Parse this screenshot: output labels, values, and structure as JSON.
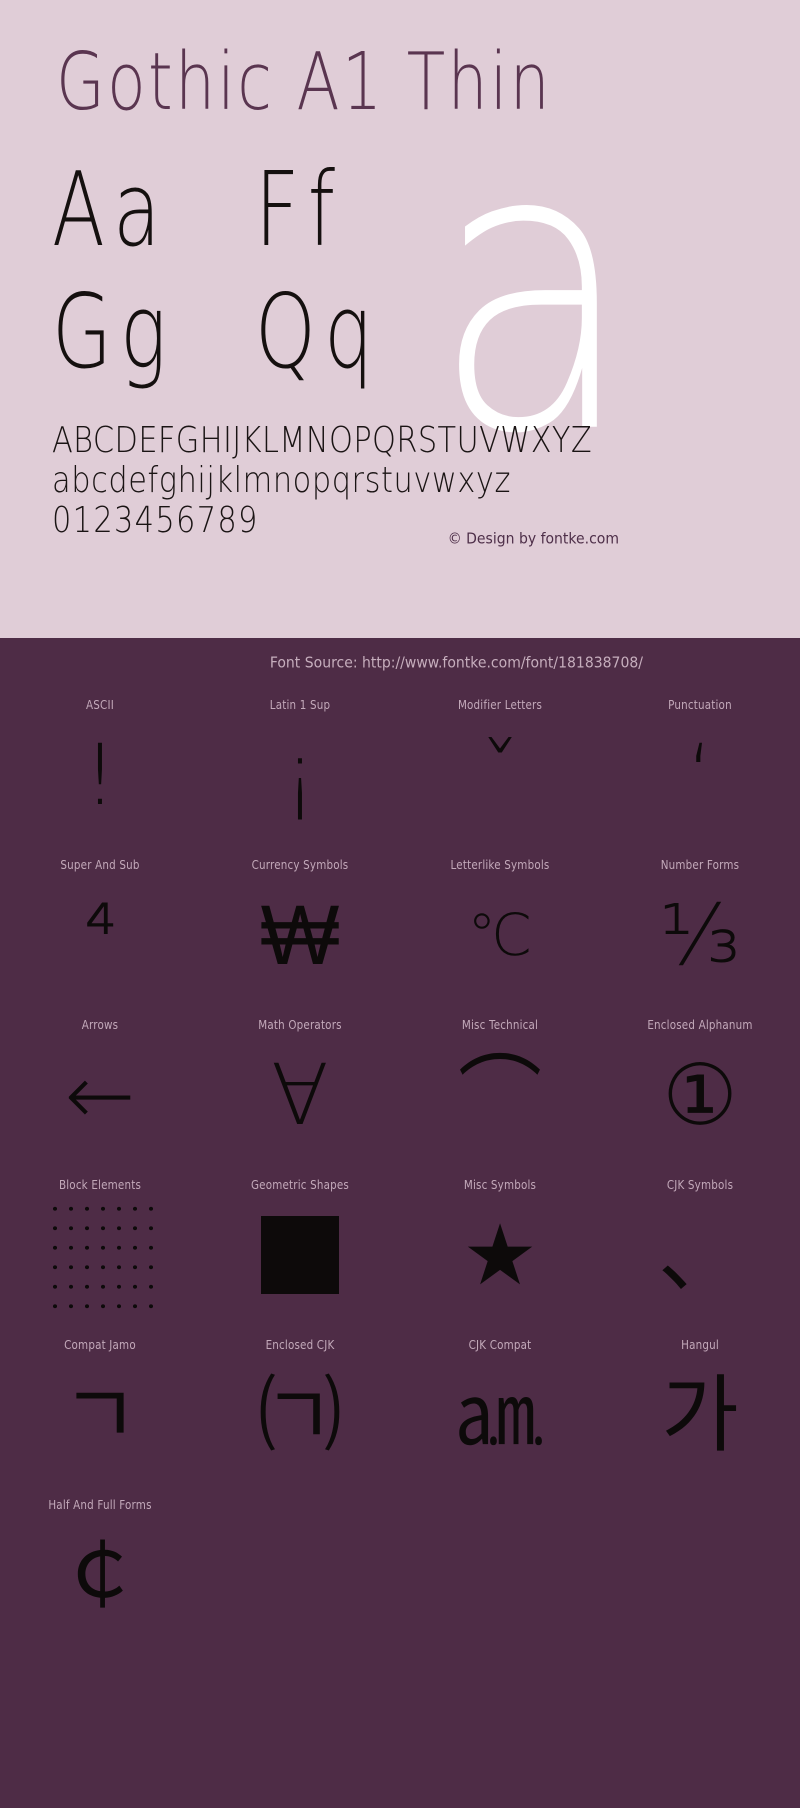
{
  "specimen": {
    "title": "Gothic A1 Thin",
    "sample_pairs": [
      "Aa",
      "Ff",
      "Gg",
      "Qq"
    ],
    "hero_glyph": "a",
    "charset": {
      "uppercase": "ABCDEFGHIJKLMNOPQRSTUVWXYZ",
      "lowercase": "abcdefghijklmnopqrstuvwxyz",
      "digits": "0123456789"
    },
    "copyright": "© Design by fontke.com",
    "font_source": "Font Source: http://www.fontke.com/font/181838708/",
    "colors": {
      "top_background": "#e0cdd7",
      "bottom_background": "#4e2c46",
      "title_color": "#5a3550",
      "glyph_color": "#0d0a0a",
      "hero_color": "#ffffff",
      "label_color": "#c3a9ba"
    }
  },
  "unicode_blocks": [
    {
      "label": "ASCII",
      "glyph": "!",
      "size": "normal"
    },
    {
      "label": "Latin 1 Sup",
      "glyph": "¡",
      "size": "normal"
    },
    {
      "label": "Modifier Letters",
      "glyph": "ˇ",
      "size": "normal"
    },
    {
      "label": "Punctuation",
      "glyph": "‘",
      "size": "normal"
    },
    {
      "label": "Super And Sub",
      "glyph": "⁴",
      "size": "normal"
    },
    {
      "label": "Currency Symbols",
      "glyph": "₩",
      "size": "normal"
    },
    {
      "label": "Letterlike Symbols",
      "glyph": "℃",
      "size": "small"
    },
    {
      "label": "Number Forms",
      "glyph": "⅓",
      "size": "normal"
    },
    {
      "label": "Arrows",
      "glyph": "←",
      "size": "normal"
    },
    {
      "label": "Math Operators",
      "glyph": "∀",
      "size": "normal"
    },
    {
      "label": "Misc Technical",
      "glyph": "⌒",
      "size": "normal"
    },
    {
      "label": "Enclosed Alphanum",
      "glyph": "①",
      "size": "normal"
    },
    {
      "label": "Block Elements",
      "glyph": "░",
      "size": "pattern"
    },
    {
      "label": "Geometric Shapes",
      "glyph": "■",
      "size": "square"
    },
    {
      "label": "Misc Symbols",
      "glyph": "★",
      "size": "normal"
    },
    {
      "label": "CJK Symbols",
      "glyph": "、",
      "size": "normal"
    },
    {
      "label": "Compat Jamo",
      "glyph": "ㄱ",
      "size": "normal"
    },
    {
      "label": "Enclosed CJK",
      "glyph": "㈀",
      "size": "normal"
    },
    {
      "label": "CJK Compat",
      "glyph": "㏂",
      "size": "normal"
    },
    {
      "label": "Hangul",
      "glyph": "가",
      "size": "normal"
    },
    {
      "label": "Half And Full Forms",
      "glyph": "￠",
      "size": "normal"
    }
  ]
}
